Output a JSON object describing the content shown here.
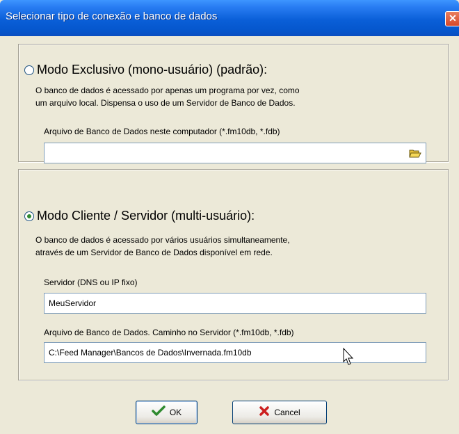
{
  "window": {
    "title": "Selecionar tipo de conexão e banco de dados",
    "close_label": "✕"
  },
  "exclusive": {
    "label": "Modo Exclusivo (mono-usuário) (padrão):",
    "desc_line1": "O banco de dados é acessado por apenas um programa por vez, como",
    "desc_line2": "um arquivo local. Dispensa o uso de um Servidor de Banco de Dados.",
    "file_label": "Arquivo de Banco de Dados neste computador (*.fm10db, *.fdb)",
    "file_value": "",
    "selected": false
  },
  "client_server": {
    "label": "Modo Cliente / Servidor (multi-usuário):",
    "desc_line1": "O banco de dados é acessado por vários usuários simultaneamente,",
    "desc_line2": "através de um Servidor de Banco de Dados disponível em rede.",
    "server_label": "Servidor (DNS ou IP fixo)",
    "server_value": "MeuServidor",
    "file_label": "Arquivo de Banco de Dados. Caminho no Servidor (*.fm10db, *.fdb)",
    "file_value": "C:\\Feed Manager\\Bancos de Dados\\Invernada.fm10db",
    "selected": true
  },
  "buttons": {
    "ok_label": "OK",
    "ok_icon": "checkmark-icon",
    "cancel_label": "Cancel",
    "cancel_icon": "x-icon"
  },
  "colors": {
    "titlebar": "#0a5fd8",
    "face": "#ece9d8",
    "check": "#2f8a2f",
    "cancel_x": "#cc1f1f"
  }
}
